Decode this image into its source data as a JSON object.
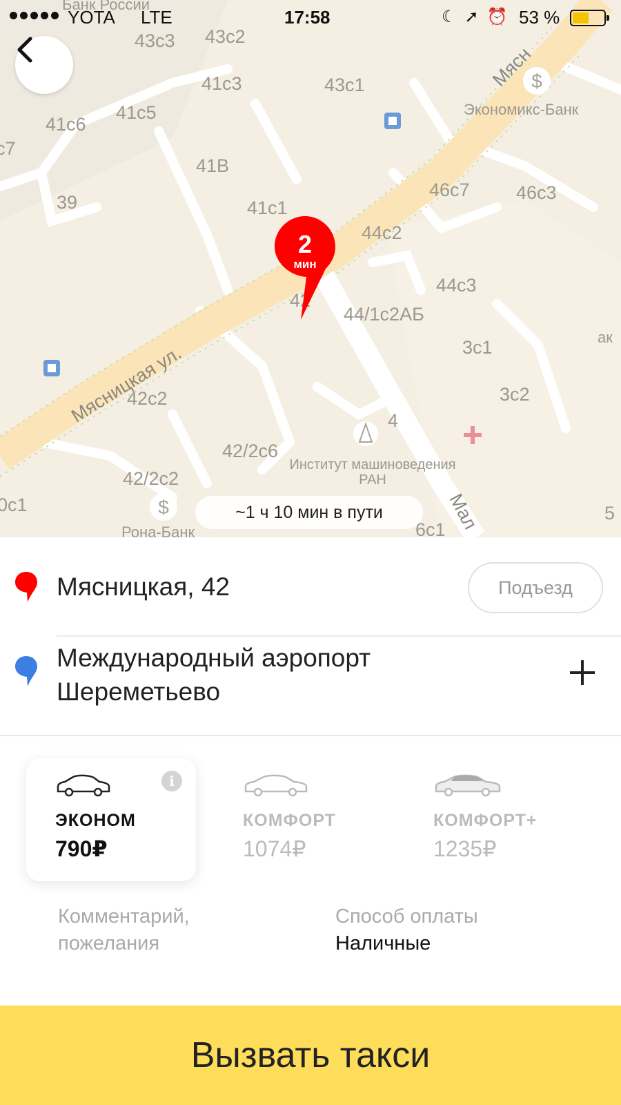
{
  "status_bar": {
    "carrier": "YOTA",
    "network": "LTE",
    "time": "17:58",
    "battery_percent": "53 %",
    "battery_level": 0.53,
    "icons": [
      "moon-icon",
      "location-arrow-icon",
      "alarm-icon"
    ]
  },
  "map": {
    "eta_pill": "~1 ч 10 мин в пути",
    "pickup_pin": {
      "number": "2",
      "unit": "мин",
      "color": "#ff0000"
    },
    "streets": [
      "Мясницкая ул.",
      "Мясн",
      "Мал"
    ],
    "buildings": [
      "Банк России",
      "43с3",
      "43с2",
      "41с3",
      "43с1",
      "41с6",
      "41с5",
      "с7",
      "41В",
      "39",
      "41с1",
      "46с7",
      "46с3",
      "44с2",
      "44с3",
      "42",
      "44/1с2АБ",
      "3с1",
      "3с2",
      "42с2",
      "4",
      "42/2с6",
      "42/2с2",
      "0с1",
      "6с1",
      "5",
      "ак"
    ],
    "pois": [
      {
        "name": "Экономикс-Банк",
        "icon": "bank-icon"
      },
      {
        "name": "Институт машиноведения РАН",
        "icon": "institute-icon"
      },
      {
        "name": "Рона-Банк",
        "icon": "bank-icon"
      },
      {
        "name": "",
        "icon": "clinic-icon"
      },
      {
        "name": "",
        "icon": "bus-stop-icon"
      }
    ]
  },
  "route": {
    "from": "Мясницкая, 42",
    "entrance_label": "Подъезд",
    "to": [
      "Международный аэропорт",
      "Шереметьево"
    ]
  },
  "tariffs": [
    {
      "name": "ЭКОНОМ",
      "price": "790₽",
      "selected": true
    },
    {
      "name": "КОМФОРТ",
      "price": "1074₽",
      "selected": false
    },
    {
      "name": "КОМФОРТ+",
      "price": "1235₽",
      "selected": false
    }
  ],
  "options": {
    "comment": [
      "Комментарий,",
      "пожелания"
    ],
    "payment_label": "Способ оплаты",
    "payment_value": "Наличные"
  },
  "call_button": "Вызвать такси",
  "colors": {
    "accent_yellow": "#fedd5b",
    "pin_red": "#ff0000",
    "destination_blue": "#3d7ee3",
    "map_background": "#f4efe2"
  }
}
